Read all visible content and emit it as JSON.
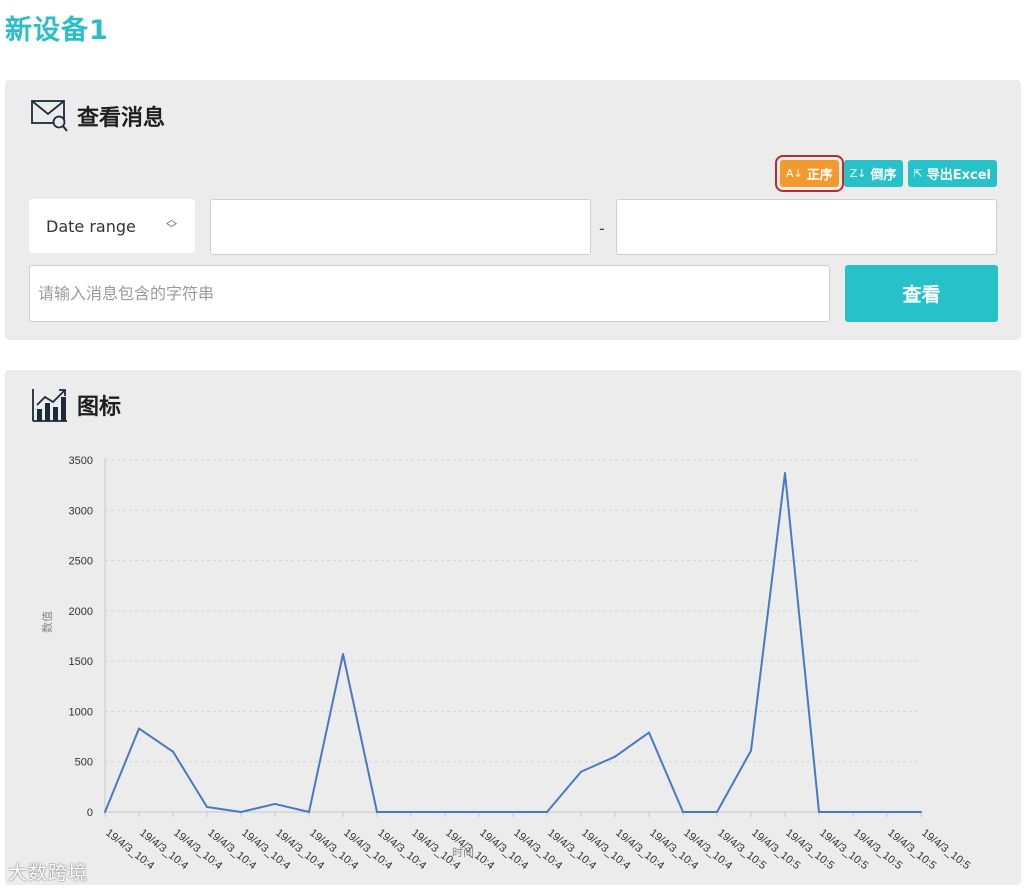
{
  "page": {
    "title": "新设备1"
  },
  "messages_panel": {
    "title": "查看消息",
    "sort_asc_label": "正序",
    "sort_desc_label": "倒序",
    "export_label": "导出Excel",
    "date_range_label": "Date range",
    "date_separator": "-",
    "date_from_value": "",
    "date_to_value": "",
    "search_placeholder": "请输入消息包含的字符串",
    "search_value": "",
    "view_button_label": "查看"
  },
  "chart_panel": {
    "title": "图标"
  },
  "chart_data": {
    "type": "line",
    "title": "",
    "xlabel": "时间",
    "ylabel": "数值",
    "ylim": [
      0,
      3500
    ],
    "yticks": [
      0,
      500,
      1000,
      1500,
      2000,
      2500,
      3000,
      3500
    ],
    "grid": true,
    "categories": [
      "19/4/3_10:4",
      "19/4/3_10:4",
      "19/4/3_10:4",
      "19/4/3_10:4",
      "19/4/3_10:4",
      "19/4/3_10:4",
      "19/4/3_10:4",
      "19/4/3_10:4",
      "19/4/3_10:4",
      "19/4/3_10:4",
      "19/4/3_10:4",
      "19/4/3_10:4",
      "19/4/3_10:4",
      "19/4/3_10:4",
      "19/4/3_10:4",
      "19/4/3_10:4",
      "19/4/3_10:4",
      "19/4/3_10:4",
      "19/4/3_10:5",
      "19/4/3_10:5",
      "19/4/3_10:5",
      "19/4/3_10:5",
      "19/4/3_10:5",
      "19/4/3_10:5",
      "19/4/3_10:5"
    ],
    "series": [
      {
        "color": "#4a78c2",
        "values": [
          0,
          830,
          600,
          50,
          0,
          80,
          0,
          1570,
          0,
          0,
          0,
          0,
          0,
          0,
          400,
          550,
          790,
          0,
          0,
          610,
          3370,
          0,
          0,
          0,
          0
        ]
      }
    ]
  },
  "watermark": "大数跨境"
}
